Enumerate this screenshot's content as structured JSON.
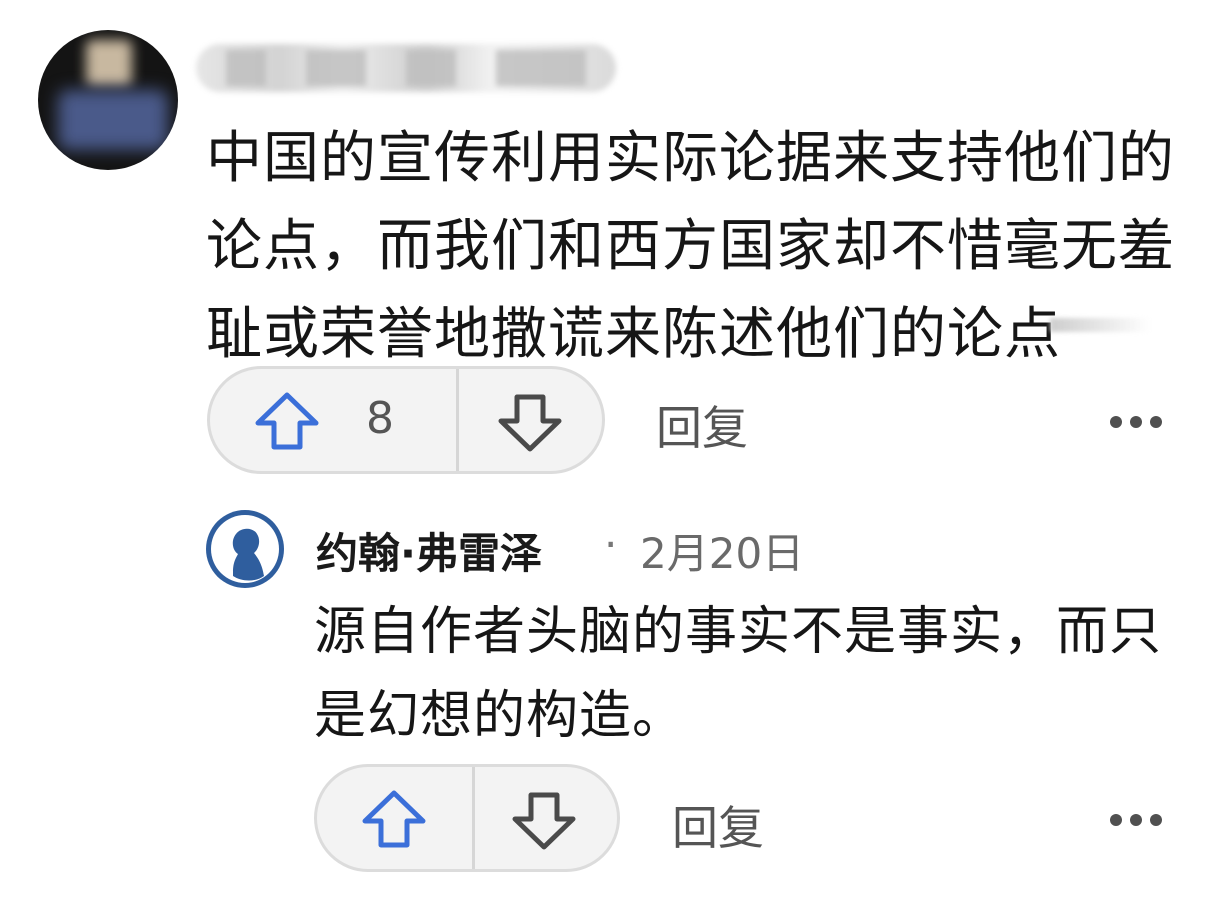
{
  "comment": {
    "author_name": "",
    "text": "中国的宣传利用实际论据来支持他们的论点，而我们和西方国家却不惜毫无羞耻或荣誉地撒谎来陈述他们的论点",
    "upvotes": "8",
    "reply_label": "回复",
    "upvote_icon": "arrow-up-icon",
    "downvote_icon": "arrow-down-icon",
    "more_icon": "more-horizontal-icon"
  },
  "reply": {
    "author_name": "约翰·弗雷泽",
    "separator": "·",
    "date": "2月20日",
    "text": "源自作者头脑的事实不是事实，而只是幻想的构造。",
    "reply_label": "回复",
    "upvote_icon": "arrow-up-icon",
    "downvote_icon": "arrow-down-icon",
    "more_icon": "more-horizontal-icon"
  },
  "colors": {
    "upvote_accent": "#3b6fd9",
    "avatar_blue": "#2f5e9e",
    "pill_bg": "#f3f3f3",
    "secondary_text": "#555555"
  }
}
